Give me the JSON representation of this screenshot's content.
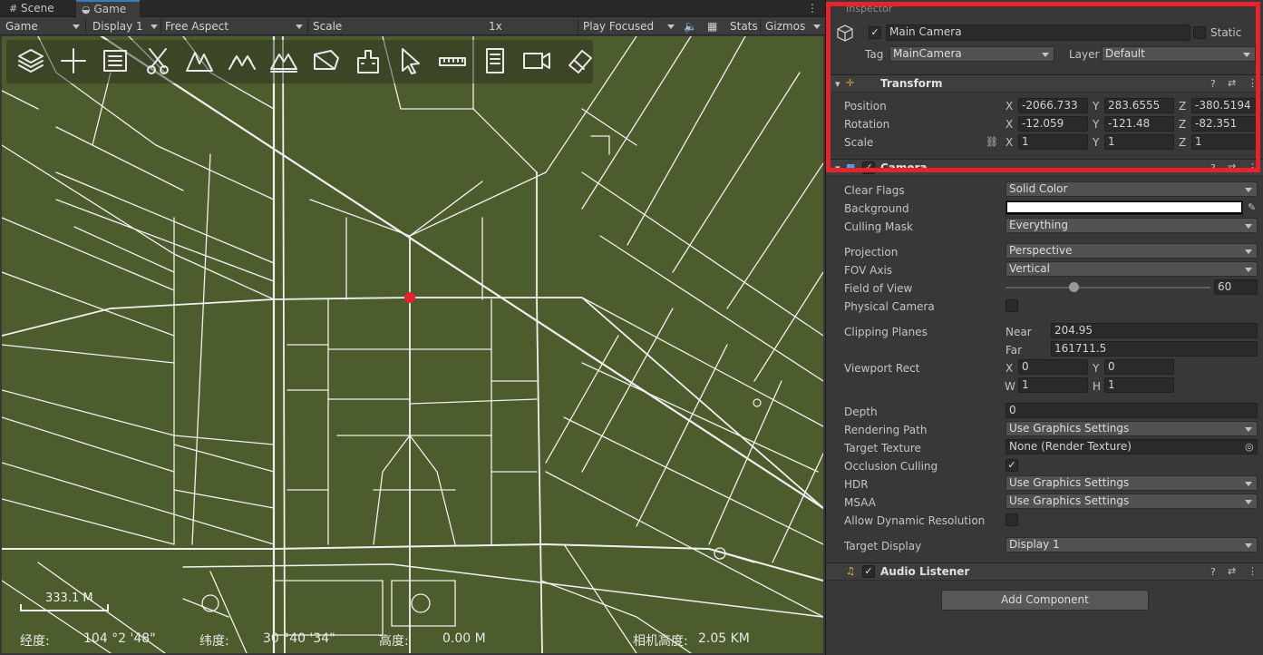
{
  "tabs": {
    "scene": "Scene",
    "game": "Game"
  },
  "toolbar": {
    "game_mode": "Game",
    "display": "Display 1",
    "aspect": "Free Aspect",
    "scale_label": "Scale",
    "scale_value": "1x",
    "play_focused": "Play Focused",
    "stats": "Stats",
    "gizmos": "Gizmos"
  },
  "map": {
    "scale_text": "333.1  M",
    "status": {
      "lon_label": "经度:",
      "lon_value": "104 °2 '48\"",
      "lat_label": "纬度:",
      "lat_value": "30 °40 '34\"",
      "alt_label": "高度:",
      "alt_value": "0.00 M",
      "cam_label": "相机高度:",
      "cam_value": "2.05  KM"
    },
    "tools": [
      "layers-icon",
      "plus-icon",
      "list-icon",
      "scissors-icon",
      "mountain-icon",
      "terrain-icon",
      "terrain-measure-icon",
      "profile-icon",
      "building-icon",
      "pointer-icon",
      "ruler-icon",
      "document-icon",
      "video-icon",
      "eraser-icon"
    ]
  },
  "inspector": {
    "title": "Inspector",
    "object_name": "Main Camera",
    "static_label": "Static",
    "tag_label": "Tag",
    "tag_value": "MainCamera",
    "layer_label": "Layer",
    "layer_value": "Default",
    "transform": {
      "title": "Transform",
      "position_label": "Position",
      "rotation_label": "Rotation",
      "scale_label": "Scale",
      "position": {
        "x": "-2066.733",
        "y": "283.6555",
        "z": "-380.5194"
      },
      "rotation": {
        "x": "-12.059",
        "y": "-121.48",
        "z": "-82.351"
      },
      "scale": {
        "x": "1",
        "y": "1",
        "z": "1"
      }
    },
    "camera": {
      "title": "Camera",
      "clear_flags_label": "Clear Flags",
      "clear_flags": "Solid Color",
      "background_label": "Background",
      "culling_mask_label": "Culling Mask",
      "culling_mask": "Everything",
      "projection_label": "Projection",
      "projection": "Perspective",
      "fov_axis_label": "FOV Axis",
      "fov_axis": "Vertical",
      "fov_label": "Field of View",
      "fov_value": "60",
      "fov_fraction": 0.33,
      "physical_label": "Physical Camera",
      "clipping_label": "Clipping Planes",
      "near_label": "Near",
      "near": "204.95",
      "far_label": "Far",
      "far": "161711.5",
      "viewport_label": "Viewport Rect",
      "vp_x": "0",
      "vp_y": "0",
      "vp_w": "1",
      "vp_h": "1",
      "depth_label": "Depth",
      "depth": "0",
      "rendering_path_label": "Rendering Path",
      "rendering_path": "Use Graphics Settings",
      "target_texture_label": "Target Texture",
      "target_texture": "None (Render Texture)",
      "occlusion_label": "Occlusion Culling",
      "hdr_label": "HDR",
      "hdr": "Use Graphics Settings",
      "msaa_label": "MSAA",
      "msaa": "Use Graphics Settings",
      "dynres_label": "Allow Dynamic Resolution",
      "target_display_label": "Target Display",
      "target_display": "Display 1"
    },
    "audio_listener": "Audio Listener",
    "add_component": "Add Component"
  },
  "colors": {
    "map_bg": "#4d5c2c",
    "road": "#ffffff",
    "marker": "#e8222a",
    "highlight": "#e8222a"
  }
}
